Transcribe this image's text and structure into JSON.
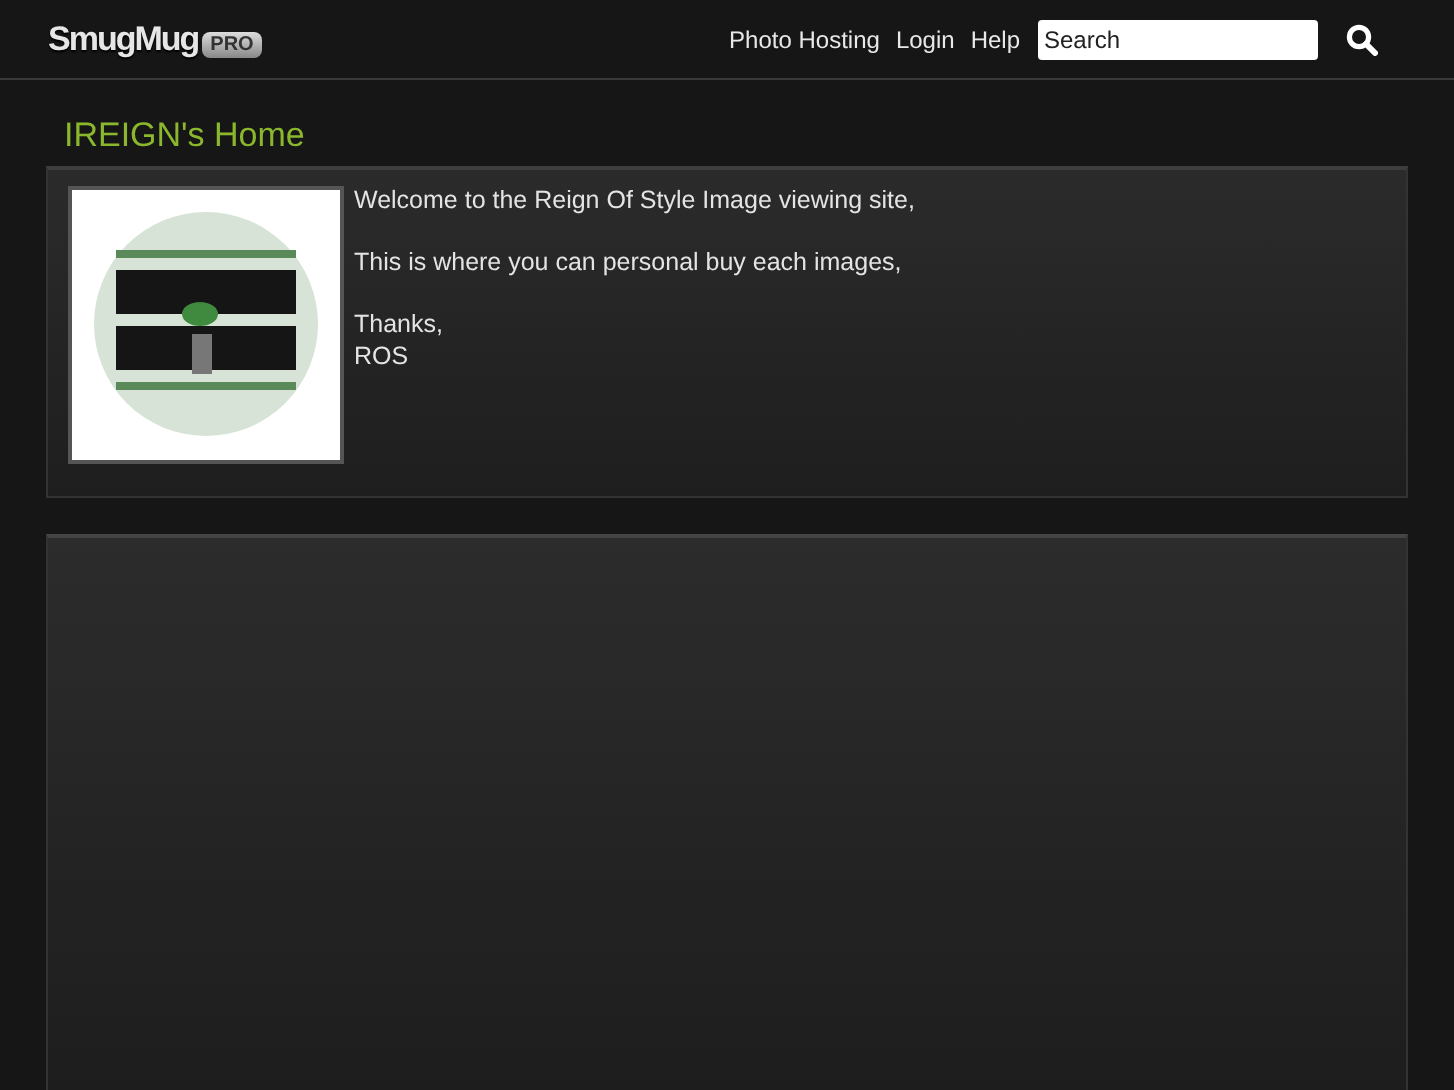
{
  "header": {
    "logo": "SmugMug",
    "badge": "PRO",
    "nav": [
      "Photo Hosting",
      "Login",
      "Help"
    ],
    "search": {
      "placeholder": "Search"
    }
  },
  "page_title": "IREIGN's Home",
  "bio": {
    "image": {
      "kind": "picture"
    },
    "paragraphs": [
      [
        "Welcome to the Reign Of Style Image viewing site,"
      ],
      [
        "This is where you can personal buy each images,"
      ],
      [
        "Thanks,",
        "ROS"
      ]
    ]
  }
}
